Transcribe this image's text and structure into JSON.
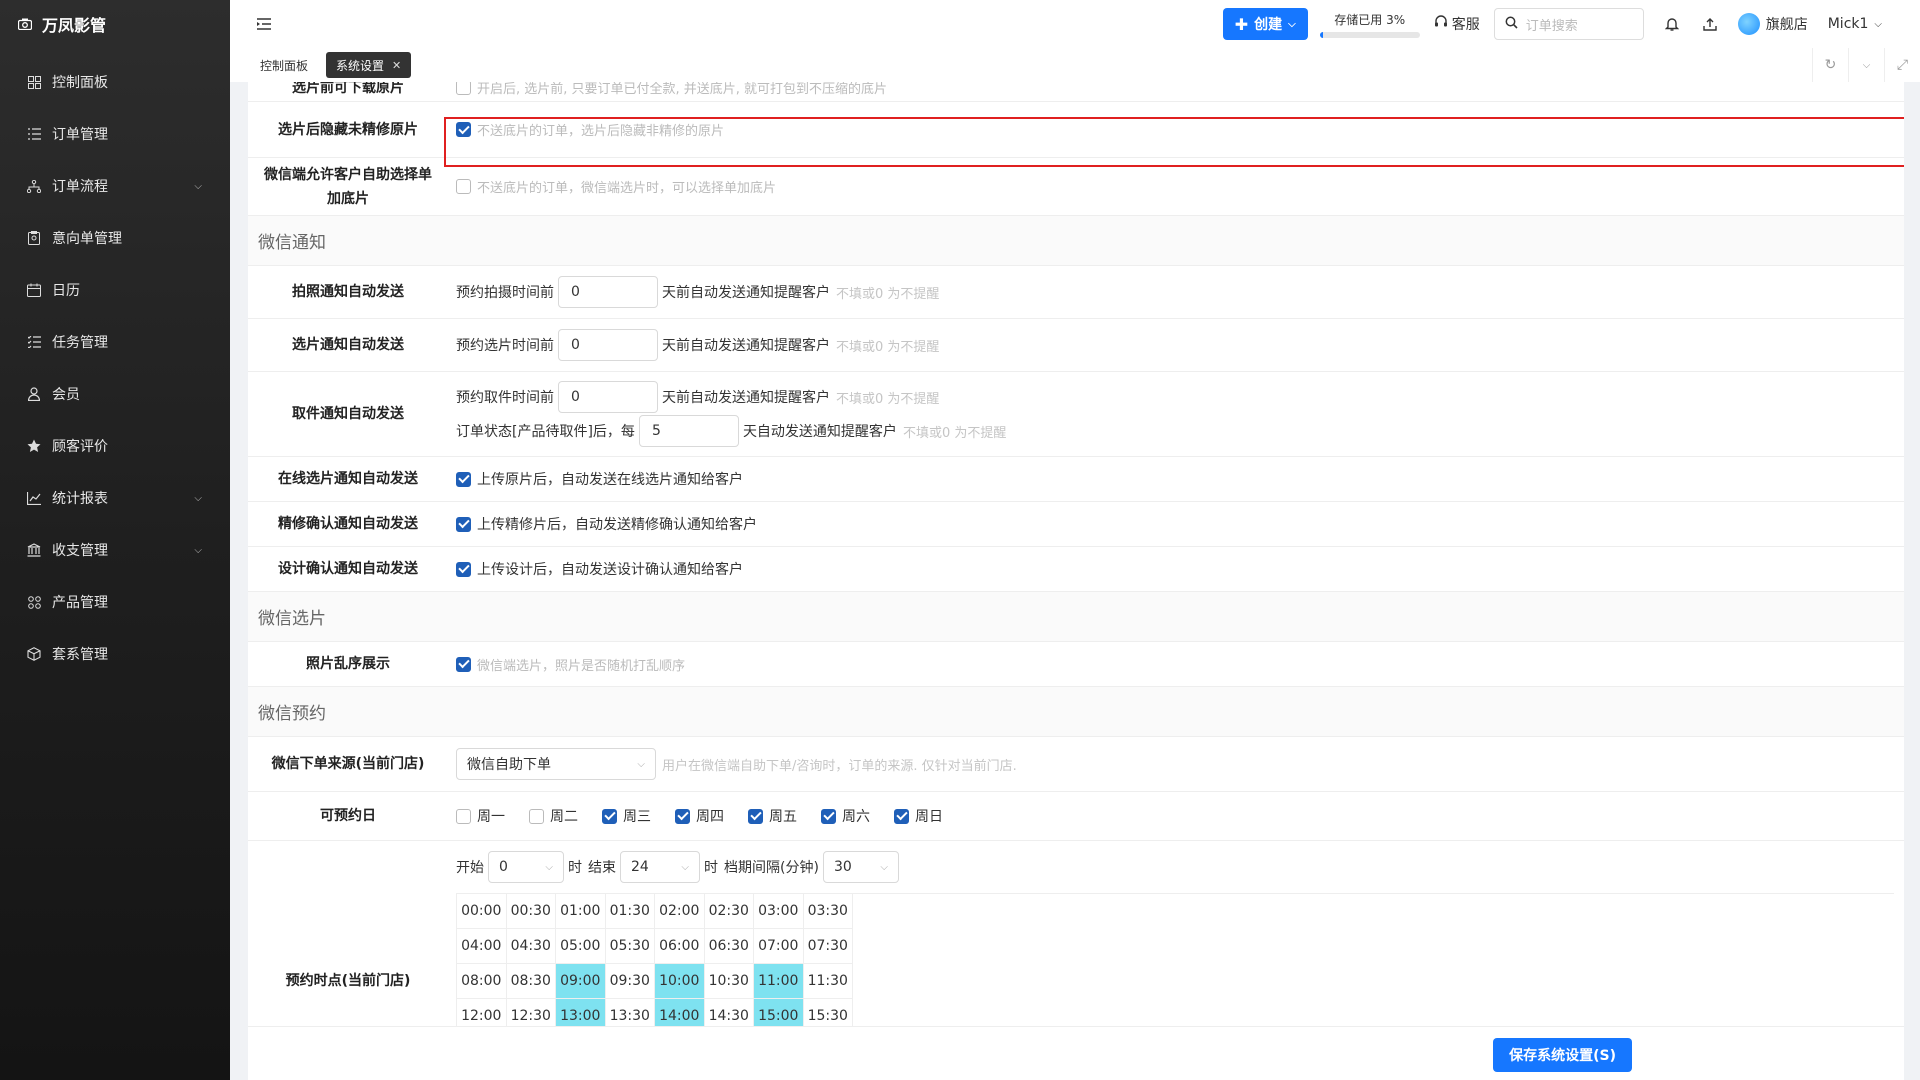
{
  "brand": {
    "name": "万凤影管"
  },
  "sidebar": {
    "items": [
      {
        "label": "控制面板",
        "icon": "grid-icon",
        "expandable": false
      },
      {
        "label": "订单管理",
        "icon": "list-icon",
        "expandable": false
      },
      {
        "label": "订单流程",
        "icon": "flow-icon",
        "expandable": true
      },
      {
        "label": "意向单管理",
        "icon": "clipboard-icon",
        "expandable": false
      },
      {
        "label": "日历",
        "icon": "calendar-icon",
        "expandable": false
      },
      {
        "label": "任务管理",
        "icon": "tasks-icon",
        "expandable": false
      },
      {
        "label": "会员",
        "icon": "user-icon",
        "expandable": false
      },
      {
        "label": "顾客评价",
        "icon": "star-icon",
        "expandable": false
      },
      {
        "label": "统计报表",
        "icon": "chart-icon",
        "expandable": true
      },
      {
        "label": "收支管理",
        "icon": "bank-icon",
        "expandable": true
      },
      {
        "label": "产品管理",
        "icon": "apps-icon",
        "expandable": false
      },
      {
        "label": "套系管理",
        "icon": "package-icon",
        "expandable": false
      }
    ]
  },
  "header": {
    "create_label": "创建",
    "storage_label": "存储已用 3%",
    "storage_percent": 3,
    "service_label": "客服",
    "search_placeholder": "订单搜索",
    "store_label": "旗舰店",
    "user_label": "Mick1"
  },
  "tabs": [
    {
      "label": "控制面板",
      "active": false
    },
    {
      "label": "系统设置",
      "active": true
    }
  ],
  "settings": {
    "top_partial": {
      "label": "选片前可下载原片",
      "text": "开启后, 选片前, 只要订单已付全款, 并送底片, 就可打包到不压缩的底片"
    },
    "hide_unretouched": {
      "label": "选片后隐藏未精修原片",
      "text": "不送底片的订单，选片后隐藏非精修的原片",
      "checked": true
    },
    "wechat_extra": {
      "label": "微信端允许客户自助选择单加底片",
      "text": "不送底片的订单，微信端选片时，可以选择单加底片",
      "checked": false
    },
    "section_notify": "微信通知",
    "shoot_notify": {
      "label": "拍照通知自动发送",
      "prefix": "预约拍摄时间前",
      "value": "0",
      "suffix": "天前自动发送通知提醒客户",
      "hint": "不填或0 为不提醒"
    },
    "select_notify": {
      "label": "选片通知自动发送",
      "prefix": "预约选片时间前",
      "value": "0",
      "suffix": "天前自动发送通知提醒客户",
      "hint": "不填或0 为不提醒"
    },
    "pickup_notify": {
      "label": "取件通知自动发送",
      "prefix": "预约取件时间前",
      "value": "0",
      "suffix": "天前自动发送通知提醒客户",
      "hint": "不填或0 为不提醒",
      "prefix2": "订单状态[产品待取件]后，每",
      "value2": "5",
      "suffix2": "天自动发送通知提醒客户",
      "hint2": "不填或0 为不提醒"
    },
    "online_notify": {
      "label": "在线选片通知自动发送",
      "text": "上传原片后，自动发送在线选片通知给客户",
      "checked": true
    },
    "retouch_notify": {
      "label": "精修确认通知自动发送",
      "text": "上传精修片后，自动发送精修确认通知给客户",
      "checked": true
    },
    "design_notify": {
      "label": "设计确认通知自动发送",
      "text": "上传设计后，自动发送设计确认通知给客户",
      "checked": true
    },
    "section_select": "微信选片",
    "shuffle": {
      "label": "照片乱序展示",
      "text": "微信端选片，照片是否随机打乱顺序",
      "checked": true
    },
    "section_booking": "微信预约",
    "order_source": {
      "label": "微信下单来源(当前门店)",
      "value": "微信自助下单",
      "hint": "用户在微信端自助下单/咨询时，订单的来源. 仅针对当前门店."
    },
    "bookable_days": {
      "label": "可预约日",
      "days": [
        {
          "name": "周一",
          "checked": false
        },
        {
          "name": "周二",
          "checked": false
        },
        {
          "name": "周三",
          "checked": true
        },
        {
          "name": "周四",
          "checked": true
        },
        {
          "name": "周五",
          "checked": true
        },
        {
          "name": "周六",
          "checked": true
        },
        {
          "name": "周日",
          "checked": true
        }
      ]
    },
    "time_slots": {
      "label": "预约时点(当前门店)",
      "start_label": "开始",
      "start_value": "0",
      "hour_label": "时",
      "end_label": "结束",
      "end_value": "24",
      "hour_label2": "时",
      "interval_label": "档期间隔(分钟)",
      "interval_value": "30",
      "rows": [
        [
          {
            "t": "00:00",
            "on": false
          },
          {
            "t": "00:30",
            "on": false
          },
          {
            "t": "01:00",
            "on": false
          },
          {
            "t": "01:30",
            "on": false
          },
          {
            "t": "02:00",
            "on": false
          },
          {
            "t": "02:30",
            "on": false
          },
          {
            "t": "03:00",
            "on": false
          },
          {
            "t": "03:30",
            "on": false
          }
        ],
        [
          {
            "t": "04:00",
            "on": false
          },
          {
            "t": "04:30",
            "on": false
          },
          {
            "t": "05:00",
            "on": false
          },
          {
            "t": "05:30",
            "on": false
          },
          {
            "t": "06:00",
            "on": false
          },
          {
            "t": "06:30",
            "on": false
          },
          {
            "t": "07:00",
            "on": false
          },
          {
            "t": "07:30",
            "on": false
          }
        ],
        [
          {
            "t": "08:00",
            "on": false
          },
          {
            "t": "08:30",
            "on": false
          },
          {
            "t": "09:00",
            "on": true
          },
          {
            "t": "09:30",
            "on": false
          },
          {
            "t": "10:00",
            "on": true
          },
          {
            "t": "10:30",
            "on": false
          },
          {
            "t": "11:00",
            "on": true
          },
          {
            "t": "11:30",
            "on": false
          }
        ],
        [
          {
            "t": "12:00",
            "on": false
          },
          {
            "t": "12:30",
            "on": false
          },
          {
            "t": "13:00",
            "on": true
          },
          {
            "t": "13:30",
            "on": false
          },
          {
            "t": "14:00",
            "on": true
          },
          {
            "t": "14:30",
            "on": false
          },
          {
            "t": "15:00",
            "on": true
          },
          {
            "t": "15:30",
            "on": false
          }
        ]
      ]
    }
  },
  "footer": {
    "save_label": "保存系统设置(S)"
  },
  "colors": {
    "accent": "#1677ff",
    "checkbox": "#1f5fb8",
    "slot_on": "#7ee2f0",
    "highlight": "#e02020"
  }
}
